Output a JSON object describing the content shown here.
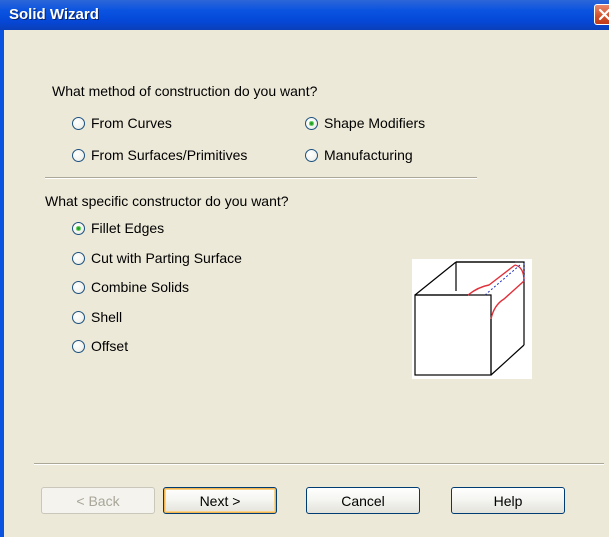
{
  "window": {
    "title": "Solid Wizard"
  },
  "construction": {
    "question": "What method of construction do you want?",
    "options": [
      {
        "label": "From Curves",
        "selected": false
      },
      {
        "label": "Shape Modifiers",
        "selected": true
      },
      {
        "label": "From Surfaces/Primitives",
        "selected": false
      },
      {
        "label": "Manufacturing",
        "selected": false
      }
    ]
  },
  "constructor": {
    "question": "What specific constructor do you want?",
    "options": [
      {
        "label": "Fillet Edges",
        "selected": true
      },
      {
        "label": "Cut with Parting Surface",
        "selected": false
      },
      {
        "label": "Combine Solids",
        "selected": false
      },
      {
        "label": "Shell",
        "selected": false
      },
      {
        "label": "Offset",
        "selected": false
      }
    ]
  },
  "buttons": {
    "back": "< Back",
    "next": "Next >",
    "cancel": "Cancel",
    "help": "Help"
  },
  "colors": {
    "titlebar": "#0A53E0",
    "dialog_bg": "#ECE9D8",
    "fillet_edge": "#E0303A",
    "hidden_edge": "#2030C0"
  },
  "icons": {
    "close": "close-icon",
    "preview": "fillet-edges-preview-icon"
  }
}
